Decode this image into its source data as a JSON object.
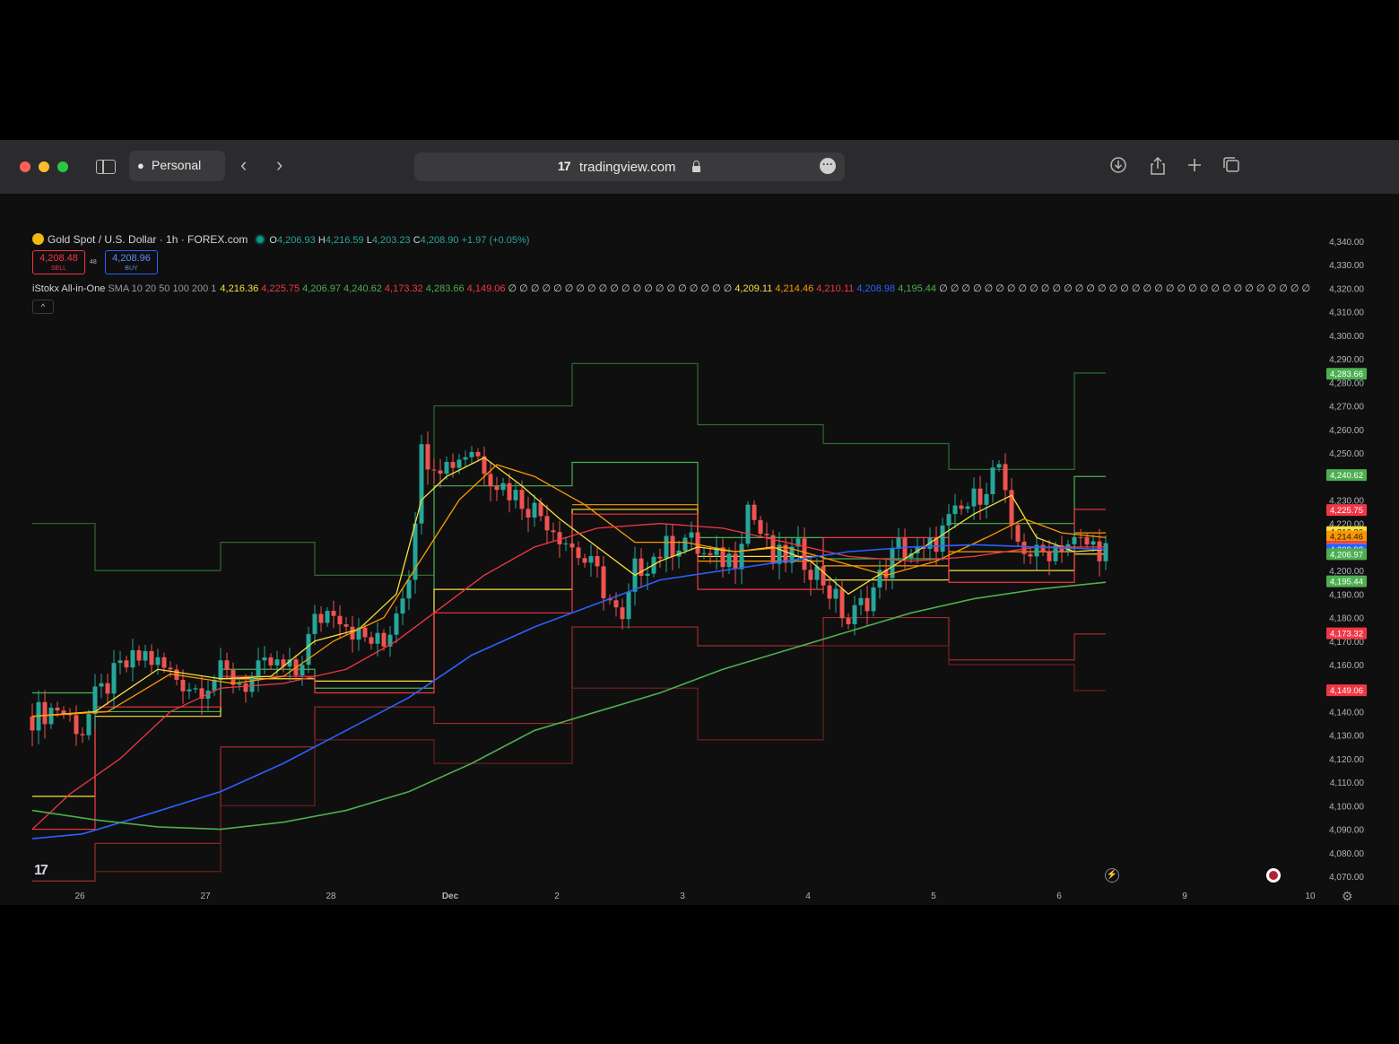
{
  "browser": {
    "profile": "Personal",
    "url": "tradingview.com",
    "logo_text": "17"
  },
  "chart_header": {
    "symbol": "Gold Spot / U.S. Dollar · 1h · FOREX.com",
    "open_label": "O",
    "open": "4,206.93",
    "high_label": "H",
    "high": "4,216.59",
    "low_label": "L",
    "low": "4,203.23",
    "close_label": "C",
    "close": "4,208.90",
    "change": "+1.97 (+0.05%)"
  },
  "trade": {
    "sell_price": "4,208.48",
    "sell_label": "SELL",
    "spread": "48",
    "buy_price": "4,208.96",
    "buy_label": "BUY"
  },
  "indicator": {
    "name": "iStokx All-in-One",
    "params": "SMA 10 20 50 100 200 1",
    "values": [
      {
        "v": "4,216.36",
        "c": "#f7e03d"
      },
      {
        "v": "4,225.75",
        "c": "#f23645"
      },
      {
        "v": "4,206.97",
        "c": "#4caf50"
      },
      {
        "v": "4,240.62",
        "c": "#4caf50"
      },
      {
        "v": "4,173.32",
        "c": "#f23645"
      },
      {
        "v": "4,283.66",
        "c": "#4caf50"
      },
      {
        "v": "4,149.06",
        "c": "#f23645"
      },
      {
        "v": "∅ ∅ ∅ ∅ ∅ ∅ ∅ ∅ ∅ ∅ ∅ ∅ ∅ ∅ ∅ ∅ ∅ ∅ ∅ ∅",
        "c": "#d1d4dc"
      },
      {
        "v": "4,209.11",
        "c": "#f7e03d"
      },
      {
        "v": "4,214.46",
        "c": "#ff9800"
      },
      {
        "v": "4,210.11",
        "c": "#f23645"
      },
      {
        "v": "4,208.98",
        "c": "#2962ff"
      },
      {
        "v": "4,195.44",
        "c": "#4caf50"
      },
      {
        "v": "∅ ∅ ∅ ∅ ∅ ∅ ∅ ∅ ∅ ∅ ∅ ∅ ∅ ∅ ∅ ∅ ∅ ∅ ∅ ∅ ∅ ∅ ∅ ∅ ∅ ∅ ∅ ∅ ∅ ∅ ∅ ∅ ∅",
        "c": "#d1d4dc"
      }
    ],
    "collapse_icon": "^"
  },
  "chart_data": {
    "type": "candlestick",
    "y_axis": {
      "min": 4070,
      "max": 4340,
      "step": 10,
      "ticks": [
        "4,340.00",
        "4,330.00",
        "4,320.00",
        "4,310.00",
        "4,300.00",
        "4,290.00",
        "4,280.00",
        "4,270.00",
        "4,260.00",
        "4,250.00",
        "4,240.00",
        "4,230.00",
        "4,220.00",
        "4,210.00",
        "4,200.00",
        "4,190.00",
        "4,180.00",
        "4,170.00",
        "4,160.00",
        "4,150.00",
        "4,140.00",
        "4,130.00",
        "4,120.00",
        "4,110.00",
        "4,100.00",
        "4,090.00",
        "4,080.00",
        "4,070.00"
      ]
    },
    "x_axis": {
      "labels": [
        {
          "t": "26",
          "i": 3
        },
        {
          "t": "27",
          "i": 23
        },
        {
          "t": "28",
          "i": 43
        },
        {
          "t": "Dec",
          "i": 62
        },
        {
          "t": "2",
          "i": 79
        },
        {
          "t": "3",
          "i": 99
        },
        {
          "t": "4",
          "i": 119
        },
        {
          "t": "5",
          "i": 139
        },
        {
          "t": "6",
          "i": 159
        },
        {
          "t": "9",
          "i": 179
        },
        {
          "t": "10",
          "i": 199
        }
      ],
      "bar_count": 172
    },
    "price_badges": [
      {
        "v": 4283.66,
        "label": "4,283.66",
        "c": "#4caf50"
      },
      {
        "v": 4240.62,
        "label": "4,240.62",
        "c": "#4caf50"
      },
      {
        "v": 4225.75,
        "label": "4,225.75",
        "c": "#f23645"
      },
      {
        "v": 4216.36,
        "label": "4,216.36",
        "c": "#f7e03d"
      },
      {
        "v": 4214.46,
        "label": "4,214.46",
        "c": "#ff9800"
      },
      {
        "v": 4210.11,
        "label": "4,210.11",
        "c": "#f23645"
      },
      {
        "v": 4209.11,
        "label": "4,209.11",
        "c": "#f7e03d"
      },
      {
        "v": 4208.98,
        "label": "4,208.98",
        "c": "#2962ff"
      },
      {
        "v": 4206.97,
        "label": "4,206.97",
        "c": "#4caf50"
      },
      {
        "v": 4195.44,
        "label": "4,195.44",
        "c": "#4caf50"
      },
      {
        "v": 4173.32,
        "label": "4,173.32",
        "c": "#f23645"
      },
      {
        "v": 4149.06,
        "label": "4,149.06",
        "c": "#f23645"
      }
    ],
    "close_path": [
      [
        0,
        4138
      ],
      [
        4,
        4142
      ],
      [
        8,
        4132
      ],
      [
        10,
        4145
      ],
      [
        14,
        4158
      ],
      [
        18,
        4164
      ],
      [
        22,
        4156
      ],
      [
        26,
        4150
      ],
      [
        30,
        4156
      ],
      [
        34,
        4152
      ],
      [
        38,
        4160
      ],
      [
        42,
        4156
      ],
      [
        45,
        4178
      ],
      [
        48,
        4185
      ],
      [
        52,
        4172
      ],
      [
        56,
        4168
      ],
      [
        60,
        4200
      ],
      [
        62,
        4250
      ],
      [
        66,
        4245
      ],
      [
        70,
        4252
      ],
      [
        74,
        4238
      ],
      [
        78,
        4230
      ],
      [
        82,
        4222
      ],
      [
        86,
        4210
      ],
      [
        90,
        4198
      ],
      [
        94,
        4176
      ],
      [
        96,
        4200
      ],
      [
        100,
        4208
      ],
      [
        104,
        4214
      ],
      [
        108,
        4204
      ],
      [
        112,
        4206
      ],
      [
        114,
        4228
      ],
      [
        118,
        4204
      ],
      [
        122,
        4208
      ],
      [
        126,
        4196
      ],
      [
        130,
        4178
      ],
      [
        134,
        4192
      ],
      [
        138,
        4210
      ],
      [
        142,
        4206
      ],
      [
        146,
        4220
      ],
      [
        150,
        4230
      ],
      [
        154,
        4245
      ],
      [
        156,
        4214
      ],
      [
        160,
        4206
      ],
      [
        164,
        4212
      ],
      [
        168,
        4211
      ],
      [
        171,
        4209
      ]
    ],
    "ma_lines": [
      {
        "c": "#f7e03d",
        "w": 1.3,
        "pts": [
          [
            0,
            4138
          ],
          [
            10,
            4140
          ],
          [
            20,
            4158
          ],
          [
            30,
            4154
          ],
          [
            38,
            4155
          ],
          [
            45,
            4170
          ],
          [
            52,
            4175
          ],
          [
            58,
            4190
          ],
          [
            62,
            4230
          ],
          [
            66,
            4240
          ],
          [
            72,
            4248
          ],
          [
            78,
            4236
          ],
          [
            84,
            4222
          ],
          [
            90,
            4210
          ],
          [
            96,
            4198
          ],
          [
            100,
            4204
          ],
          [
            106,
            4210
          ],
          [
            112,
            4208
          ],
          [
            118,
            4210
          ],
          [
            124,
            4204
          ],
          [
            130,
            4190
          ],
          [
            136,
            4200
          ],
          [
            142,
            4210
          ],
          [
            150,
            4224
          ],
          [
            156,
            4232
          ],
          [
            160,
            4214
          ],
          [
            166,
            4208
          ],
          [
            171,
            4209
          ]
        ]
      },
      {
        "c": "#ff9800",
        "w": 1.3,
        "pts": [
          [
            0,
            4138
          ],
          [
            12,
            4140
          ],
          [
            22,
            4156
          ],
          [
            32,
            4152
          ],
          [
            40,
            4155
          ],
          [
            48,
            4170
          ],
          [
            56,
            4180
          ],
          [
            62,
            4205
          ],
          [
            68,
            4230
          ],
          [
            74,
            4245
          ],
          [
            80,
            4240
          ],
          [
            88,
            4228
          ],
          [
            96,
            4212
          ],
          [
            104,
            4212
          ],
          [
            112,
            4208
          ],
          [
            120,
            4210
          ],
          [
            128,
            4204
          ],
          [
            136,
            4198
          ],
          [
            144,
            4204
          ],
          [
            152,
            4214
          ],
          [
            158,
            4222
          ],
          [
            164,
            4216
          ],
          [
            171,
            4214
          ]
        ]
      },
      {
        "c": "#f23645",
        "w": 1.3,
        "pts": [
          [
            0,
            4090
          ],
          [
            6,
            4105
          ],
          [
            14,
            4120
          ],
          [
            22,
            4140
          ],
          [
            30,
            4150
          ],
          [
            40,
            4152
          ],
          [
            50,
            4158
          ],
          [
            58,
            4170
          ],
          [
            64,
            4182
          ],
          [
            72,
            4198
          ],
          [
            80,
            4210
          ],
          [
            90,
            4218
          ],
          [
            100,
            4220
          ],
          [
            110,
            4218
          ],
          [
            120,
            4212
          ],
          [
            130,
            4206
          ],
          [
            140,
            4204
          ],
          [
            150,
            4206
          ],
          [
            160,
            4210
          ],
          [
            171,
            4210
          ]
        ]
      },
      {
        "c": "#2962ff",
        "w": 1.6,
        "pts": [
          [
            0,
            4086
          ],
          [
            8,
            4088
          ],
          [
            18,
            4096
          ],
          [
            30,
            4106
          ],
          [
            40,
            4118
          ],
          [
            50,
            4132
          ],
          [
            60,
            4146
          ],
          [
            70,
            4164
          ],
          [
            80,
            4176
          ],
          [
            90,
            4186
          ],
          [
            100,
            4196
          ],
          [
            110,
            4200
          ],
          [
            120,
            4204
          ],
          [
            130,
            4208
          ],
          [
            140,
            4210
          ],
          [
            150,
            4211
          ],
          [
            160,
            4210
          ],
          [
            171,
            4209
          ]
        ]
      },
      {
        "c": "#4caf50",
        "w": 1.6,
        "pts": [
          [
            0,
            4098
          ],
          [
            10,
            4094
          ],
          [
            20,
            4091
          ],
          [
            30,
            4090
          ],
          [
            40,
            4093
          ],
          [
            50,
            4098
          ],
          [
            60,
            4106
          ],
          [
            70,
            4118
          ],
          [
            80,
            4132
          ],
          [
            90,
            4140
          ],
          [
            100,
            4148
          ],
          [
            110,
            4158
          ],
          [
            120,
            4166
          ],
          [
            130,
            4174
          ],
          [
            140,
            4182
          ],
          [
            150,
            4188
          ],
          [
            160,
            4192
          ],
          [
            171,
            4195
          ]
        ]
      }
    ],
    "step_lines": [
      {
        "c": "#2e6b30",
        "segs": [
          [
            0,
            10,
            4220
          ],
          [
            10,
            30,
            4200
          ],
          [
            30,
            45,
            4212
          ],
          [
            45,
            64,
            4198
          ],
          [
            64,
            86,
            4270
          ],
          [
            86,
            106,
            4288
          ],
          [
            106,
            126,
            4262
          ],
          [
            126,
            146,
            4254
          ],
          [
            146,
            166,
            4243
          ],
          [
            166,
            171,
            4284
          ]
        ]
      },
      {
        "c": "#4caf50",
        "segs": [
          [
            0,
            10,
            4148
          ],
          [
            10,
            30,
            4140
          ],
          [
            30,
            45,
            4158
          ],
          [
            45,
            64,
            4150
          ],
          [
            64,
            86,
            4236
          ],
          [
            86,
            106,
            4246
          ],
          [
            106,
            126,
            4214
          ],
          [
            126,
            146,
            4205
          ],
          [
            146,
            166,
            4220
          ],
          [
            166,
            171,
            4240
          ]
        ]
      },
      {
        "c": "#f7e03d",
        "segs": [
          [
            0,
            10,
            4104
          ],
          [
            10,
            30,
            4138
          ],
          [
            30,
            45,
            4154
          ],
          [
            45,
            64,
            4153
          ],
          [
            64,
            86,
            4192
          ],
          [
            86,
            106,
            4226
          ],
          [
            106,
            126,
            4206
          ],
          [
            126,
            146,
            4196
          ],
          [
            146,
            166,
            4200
          ],
          [
            166,
            171,
            4207
          ]
        ]
      },
      {
        "c": "#ff9800",
        "segs": [
          [
            86,
            106,
            4228
          ],
          [
            106,
            126,
            4204
          ],
          [
            126,
            146,
            4202
          ],
          [
            146,
            166,
            4208
          ],
          [
            166,
            171,
            4216
          ]
        ]
      },
      {
        "c": "#f23645",
        "segs": [
          [
            0,
            10,
            4090
          ],
          [
            10,
            30,
            4142
          ],
          [
            30,
            45,
            4155
          ],
          [
            45,
            64,
            4148
          ],
          [
            64,
            86,
            4182
          ],
          [
            86,
            106,
            4224
          ],
          [
            106,
            126,
            4192
          ],
          [
            126,
            146,
            4214
          ],
          [
            146,
            166,
            4195
          ],
          [
            166,
            171,
            4226
          ]
        ]
      },
      {
        "c": "#a32a2a",
        "segs": [
          [
            0,
            10,
            4068
          ],
          [
            10,
            30,
            4084
          ],
          [
            30,
            45,
            4125
          ],
          [
            45,
            64,
            4142
          ],
          [
            64,
            86,
            4135
          ],
          [
            86,
            106,
            4176
          ],
          [
            106,
            126,
            4168
          ],
          [
            126,
            146,
            4180
          ],
          [
            146,
            166,
            4162
          ],
          [
            166,
            171,
            4173
          ]
        ]
      },
      {
        "c": "#6e1f1f",
        "segs": [
          [
            10,
            30,
            4072
          ],
          [
            30,
            45,
            4100
          ],
          [
            45,
            64,
            4128
          ],
          [
            64,
            86,
            4118
          ],
          [
            86,
            106,
            4150
          ],
          [
            106,
            126,
            4128
          ],
          [
            126,
            146,
            4168
          ],
          [
            146,
            166,
            4160
          ],
          [
            166,
            171,
            4149
          ]
        ]
      }
    ]
  },
  "icons": {
    "tv_logo": "17",
    "bolt": "⚡",
    "gear": "⚙"
  }
}
